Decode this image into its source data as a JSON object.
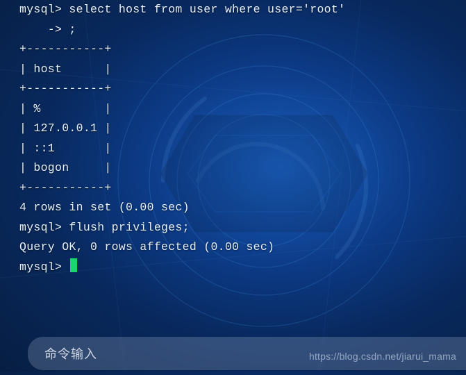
{
  "session": {
    "lines": [
      "mysql> select host from user where user='root'",
      "    -> ;",
      "+-----------+",
      "| host      |",
      "+-----------+",
      "| %         |",
      "| 127.0.0.1 |",
      "| ::1       |",
      "| bogon     |",
      "+-----------+",
      "4 rows in set (0.00 sec)",
      "",
      "mysql> flush privileges;",
      "Query OK, 0 rows affected (0.00 sec)",
      "",
      "mysql> "
    ],
    "prompt": "mysql>",
    "queries": [
      "select host from user where user='root';",
      "flush privileges;"
    ],
    "result_table": {
      "columns": [
        "host"
      ],
      "rows": [
        [
          "%"
        ],
        [
          "127.0.0.1"
        ],
        [
          "::1"
        ],
        [
          "bogon"
        ]
      ],
      "summary": "4 rows in set (0.00 sec)"
    },
    "second_result": "Query OK, 0 rows affected (0.00 sec)"
  },
  "input_bar": {
    "placeholder": "命令输入"
  },
  "watermark": "https://blog.csdn.net/jiarui_mama"
}
